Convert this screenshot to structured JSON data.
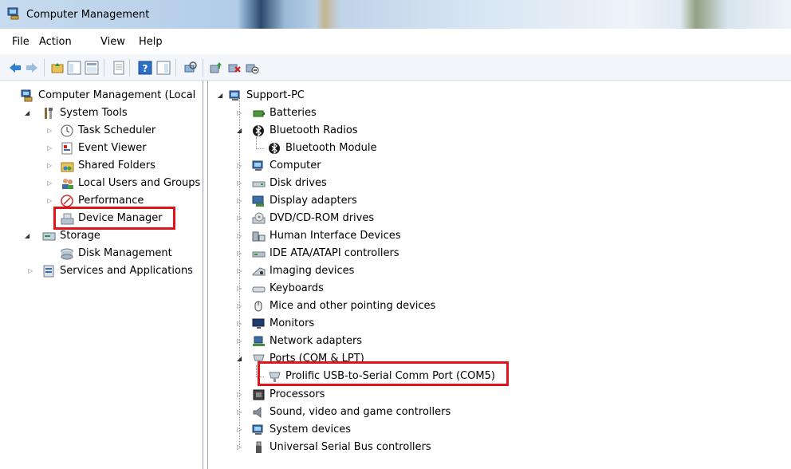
{
  "window": {
    "title": "Computer Management"
  },
  "menu": {
    "file": "File",
    "action": "Action",
    "view": "View",
    "help": "Help"
  },
  "toolbar": {
    "buttons": [
      "back-icon",
      "forward-icon",
      "up-folder-icon",
      "show-hide-console-tree-icon",
      "properties-icon",
      "export-list-icon",
      "help-icon",
      "show-action-pane-icon",
      "scan-hardware-icon",
      "update-driver-icon",
      "uninstall-device-icon",
      "disable-device-icon"
    ]
  },
  "left_tree": {
    "root": "Computer Management (Local",
    "system_tools": "System Tools",
    "task_scheduler": "Task Scheduler",
    "event_viewer": "Event Viewer",
    "shared_folders": "Shared Folders",
    "local_users": "Local Users and Groups",
    "performance": "Performance",
    "device_manager": "Device Manager",
    "storage": "Storage",
    "disk_management": "Disk Management",
    "services": "Services and Applications"
  },
  "device_tree": {
    "root": "Support-PC",
    "items": [
      "Batteries",
      "Bluetooth Radios",
      "Bluetooth Module",
      "Computer",
      "Disk drives",
      "Display adapters",
      "DVD/CD-ROM drives",
      "Human Interface Devices",
      "IDE ATA/ATAPI controllers",
      "Imaging devices",
      "Keyboards",
      "Mice and other pointing devices",
      "Monitors",
      "Network adapters",
      "Ports (COM & LPT)",
      "Prolific USB-to-Serial Comm Port (COM5)",
      "Processors",
      "Sound, video and game controllers",
      "System devices",
      "Universal Serial Bus controllers"
    ]
  },
  "colors": {
    "highlight": "#e0151b",
    "tree_line": "#9a9a9a"
  }
}
